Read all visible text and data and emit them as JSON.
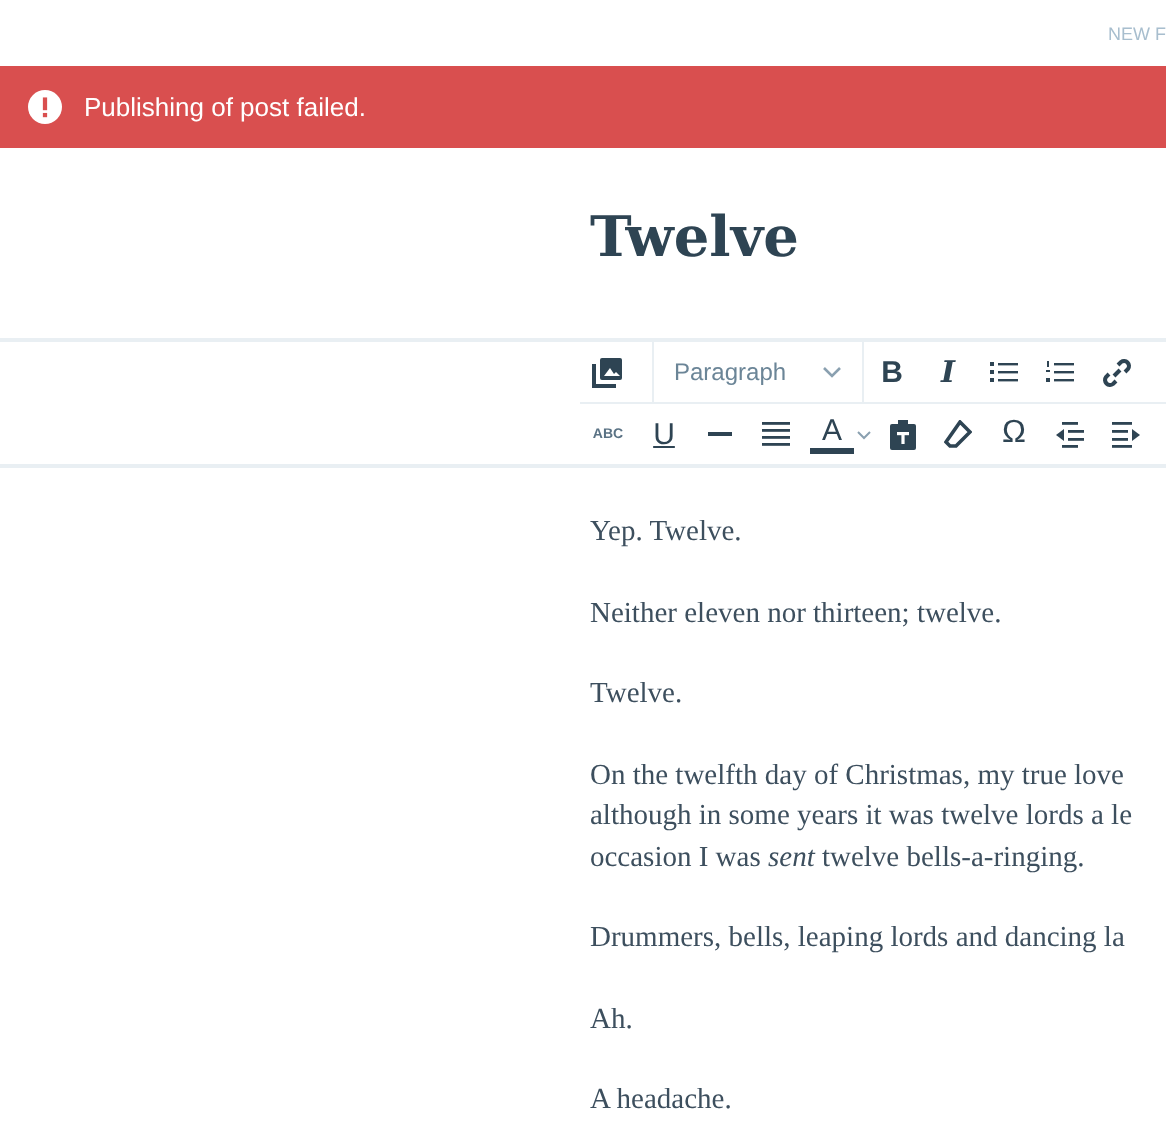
{
  "top_link": "NEW F",
  "notice": {
    "kind": "error",
    "text": "Publishing of post failed."
  },
  "title": "Twelve",
  "toolbar": {
    "format": "Paragraph",
    "bold": "B",
    "italic": "I",
    "underline": "U",
    "text_color": "A",
    "special_char": "Ω",
    "strikethrough": "ABC"
  },
  "paragraphs": [
    {
      "lines": [
        "Yep. Twelve."
      ]
    },
    {
      "lines": [
        "Neither eleven nor thirteen; twelve."
      ]
    },
    {
      "lines": [
        "Twelve."
      ]
    },
    {
      "lines": [
        "On the twelfth day of Christmas, my true love",
        "although in some years it was twelve lords a le",
        "occasion I was *sent* twelve bells-a-ringing."
      ]
    },
    {
      "lines": [
        "Drummers, bells, leaping lords and dancing la"
      ]
    },
    {
      "lines": [
        "Ah."
      ]
    },
    {
      "lines": [
        "A headache."
      ]
    }
  ]
}
